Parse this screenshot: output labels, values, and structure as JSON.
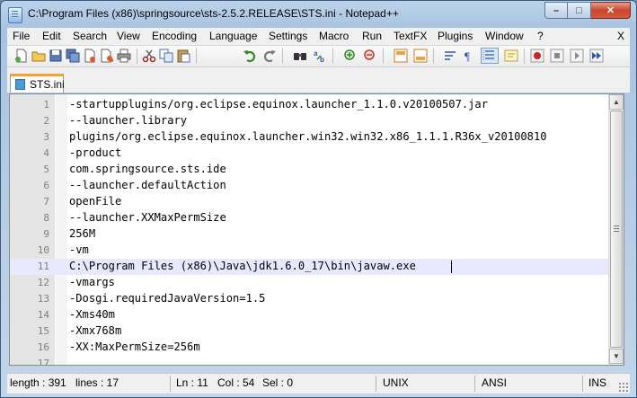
{
  "window": {
    "title": "C:\\Program Files (x86)\\springsource\\sts-2.5.2.RELEASE\\STS.ini - Notepad++",
    "controls": {
      "minimize": "–",
      "maximize": "□",
      "close": "✕"
    }
  },
  "menu": {
    "items": [
      "File",
      "Edit",
      "Search",
      "View",
      "Encoding",
      "Language",
      "Settings",
      "Macro",
      "Run",
      "TextFX",
      "Plugins",
      "Window",
      "?"
    ],
    "close": "X"
  },
  "toolbar": {
    "icons": [
      "new-file-icon",
      "open-file-icon",
      "save-icon",
      "save-all-icon",
      "close-icon",
      "close-all-icon",
      "print-icon",
      "cut-icon",
      "copy-icon",
      "paste-icon",
      "undo-icon",
      "redo-icon",
      "find-icon",
      "replace-icon",
      "zoom-in-icon",
      "zoom-out-icon",
      "sync-vertical-icon",
      "sync-horizontal-icon",
      "word-wrap-icon",
      "show-all-chars-icon",
      "indent-guide-icon",
      "user-lang-icon",
      "record-macro-icon",
      "stop-record-icon",
      "play-macro-icon",
      "play-macro-multiple-icon",
      "save-macro-icon"
    ]
  },
  "tab": {
    "label": "STS.ini",
    "color": "#f7a22c"
  },
  "editor": {
    "current_line": 11,
    "lines": [
      {
        "n": "1",
        "text": "-startupplugins/org.eclipse.equinox.launcher_1.1.0.v20100507.jar"
      },
      {
        "n": "2",
        "text": "--launcher.library"
      },
      {
        "n": "3",
        "text": "plugins/org.eclipse.equinox.launcher.win32.win32.x86_1.1.1.R36x_v20100810"
      },
      {
        "n": "4",
        "text": "-product"
      },
      {
        "n": "5",
        "text": "com.springsource.sts.ide"
      },
      {
        "n": "6",
        "text": "--launcher.defaultAction"
      },
      {
        "n": "7",
        "text": "openFile"
      },
      {
        "n": "8",
        "text": "--launcher.XXMaxPermSize"
      },
      {
        "n": "9",
        "text": "256M"
      },
      {
        "n": "10",
        "text": "-vm"
      },
      {
        "n": "11",
        "text": "C:\\Program Files (x86)\\Java\\jdk1.6.0_17\\bin\\javaw.exe"
      },
      {
        "n": "12",
        "text": "-vmargs"
      },
      {
        "n": "13",
        "text": "-Dosgi.requiredJavaVersion=1.5"
      },
      {
        "n": "14",
        "text": "-Xms40m"
      },
      {
        "n": "15",
        "text": "-Xmx768m"
      },
      {
        "n": "16",
        "text": "-XX:MaxPermSize=256m"
      },
      {
        "n": "17",
        "text": ""
      }
    ]
  },
  "status": {
    "length": "length : 391",
    "lines": "lines : 17",
    "ln": "Ln : 11",
    "col": "Col : 54",
    "sel": "Sel : 0",
    "eol": "UNIX",
    "encoding": "ANSI",
    "mode": "INS"
  }
}
